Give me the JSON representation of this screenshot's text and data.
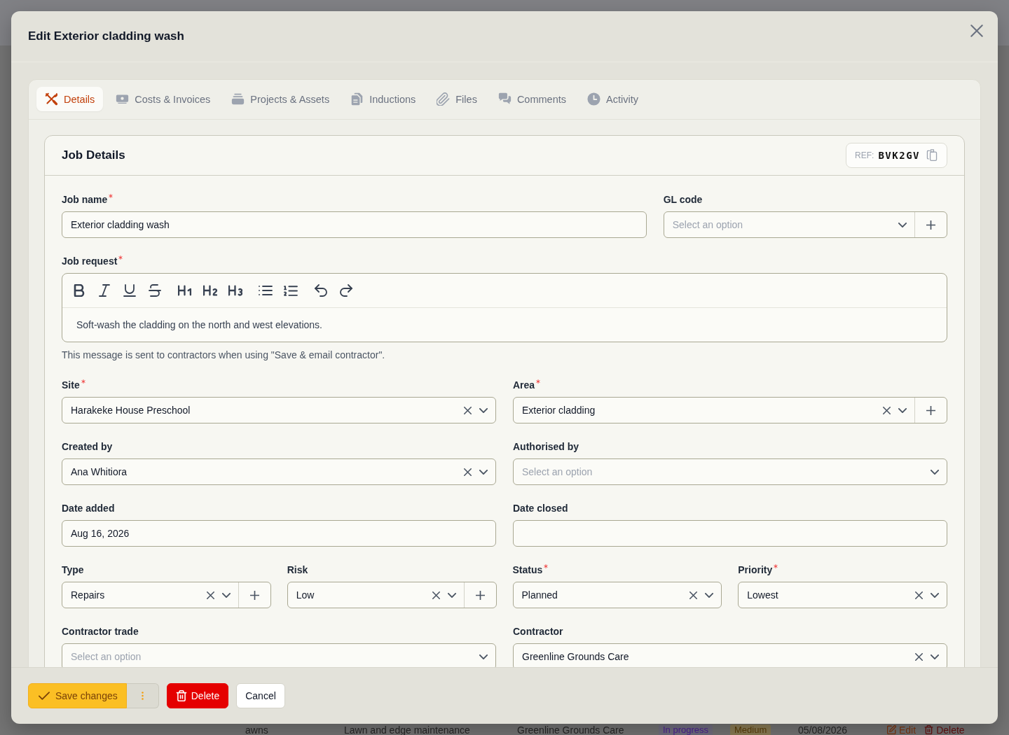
{
  "modal": {
    "title": "Edit Exterior cladding wash"
  },
  "tabs": [
    {
      "label": "Details",
      "selected": true
    },
    {
      "label": "Costs & Invoices",
      "selected": false
    },
    {
      "label": "Projects & Assets",
      "selected": false
    },
    {
      "label": "Inductions",
      "selected": false
    },
    {
      "label": "Files",
      "selected": false
    },
    {
      "label": "Comments",
      "selected": false
    },
    {
      "label": "Activity",
      "selected": false
    }
  ],
  "card": {
    "title": "Job Details",
    "ref_label": "REF:",
    "ref_value": "BVK2GV"
  },
  "form": {
    "rows": [
      {
        "fields": [
          {
            "label": "Job name",
            "required": true,
            "kind": "text",
            "value": "Exterior cladding wash"
          },
          {
            "label": "GL code",
            "required": false,
            "kind": "select",
            "placeholder": "Select an option",
            "add_button": true
          }
        ]
      },
      {
        "fields": [
          {
            "label": "Job request",
            "required": true,
            "kind": "editor",
            "value": "Soft-wash the cladding on the north and west elevations.",
            "help": "This message is sent to contractors when using \"Save & email contractor\"."
          }
        ]
      },
      {
        "fields": [
          {
            "label": "Site",
            "required": true,
            "kind": "select",
            "value": "Harakeke House Preschool",
            "add_button": false
          },
          {
            "label": "Area",
            "required": true,
            "kind": "select",
            "value": "Exterior cladding",
            "add_button": true
          }
        ]
      },
      {
        "fields": [
          {
            "label": "Created by",
            "required": false,
            "kind": "select",
            "value": "Ana Whitiora",
            "add_button": false
          },
          {
            "label": "Authorised by",
            "required": false,
            "kind": "select",
            "placeholder": "Select an option",
            "add_button": false
          }
        ]
      },
      {
        "fields": [
          {
            "label": "Date added",
            "required": false,
            "kind": "text",
            "value": "Aug 16, 2026"
          },
          {
            "label": "Date closed",
            "required": false,
            "kind": "text"
          }
        ]
      },
      {
        "fields": [
          {
            "label": "Type",
            "required": false,
            "kind": "select",
            "value": "Repairs",
            "add_button": true
          },
          {
            "label": "Risk",
            "required": false,
            "kind": "select",
            "value": "Low",
            "add_button": true
          },
          {
            "label": "Status",
            "required": true,
            "kind": "select",
            "value": "Planned",
            "add_button": false
          },
          {
            "label": "Priority",
            "required": true,
            "kind": "select",
            "value": "Lowest",
            "add_button": false
          }
        ]
      },
      {
        "fields": [
          {
            "label": "Contractor trade",
            "required": false,
            "kind": "select",
            "placeholder": "Select an option",
            "add_button": false
          },
          {
            "label": "Contractor",
            "required": false,
            "kind": "select",
            "value": "Greenline Grounds Care",
            "add_button": false
          }
        ]
      }
    ]
  },
  "footer": {
    "buttons": [
      {
        "label": "Save changes",
        "kind": "primary"
      },
      {
        "label": "Delete",
        "kind": "danger"
      },
      {
        "label": "Cancel",
        "kind": "plain"
      }
    ]
  },
  "background_row": {
    "cells": [
      "awns",
      "Lawn and edge maintenance",
      "Greenline Grounds Care"
    ],
    "status": "In progress",
    "priority": "Medium",
    "date": "05/08/2026",
    "actions": [
      {
        "label": "Edit",
        "kind": "edit"
      },
      {
        "label": "Delete",
        "kind": "delete"
      }
    ]
  }
}
